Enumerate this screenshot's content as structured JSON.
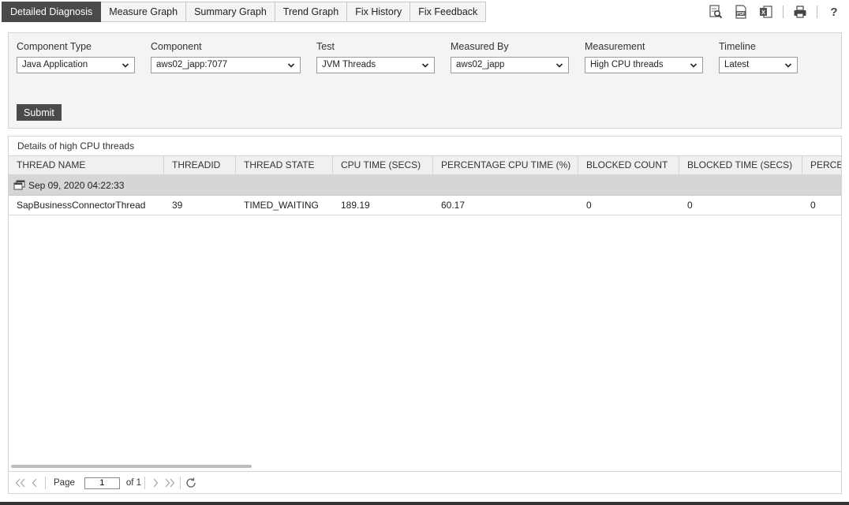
{
  "tabs": [
    {
      "label": "Detailed Diagnosis",
      "active": true
    },
    {
      "label": "Measure Graph"
    },
    {
      "label": "Summary Graph"
    },
    {
      "label": "Trend Graph"
    },
    {
      "label": "Fix History"
    },
    {
      "label": "Fix Feedback"
    }
  ],
  "toolbar": {
    "help_label": "?"
  },
  "filters": {
    "component_type": {
      "label": "Component Type",
      "value": "Java Application"
    },
    "component": {
      "label": "Component",
      "value": "aws02_japp:7077"
    },
    "test": {
      "label": "Test",
      "value": "JVM Threads"
    },
    "measured_by": {
      "label": "Measured By",
      "value": "aws02_japp"
    },
    "measurement": {
      "label": "Measurement",
      "value": "High CPU threads"
    },
    "timeline": {
      "label": "Timeline",
      "value": "Latest"
    },
    "submit_label": "Submit"
  },
  "results": {
    "title": "Details of high CPU threads",
    "columns": [
      "THREAD NAME",
      "THREADID",
      "THREAD STATE",
      "CPU TIME (SECS)",
      "PERCENTAGE CPU TIME (%)",
      "BLOCKED COUNT",
      "BLOCKED TIME (SECS)",
      "PERCEN"
    ],
    "group_label": "Sep 09, 2020 04:22:33",
    "rows": [
      [
        "SapBusinessConnectorThread",
        "39",
        "TIMED_WAITING",
        "189.19",
        "60.17",
        "0",
        "0",
        "0"
      ]
    ]
  },
  "pager": {
    "page_label": "Page",
    "page_value": "1",
    "of_label": "of 1"
  },
  "colors": {
    "active_tab": "#4a4a4a",
    "panel_bg": "#f4f4f4",
    "group_row_bg": "#d6d6d6"
  }
}
